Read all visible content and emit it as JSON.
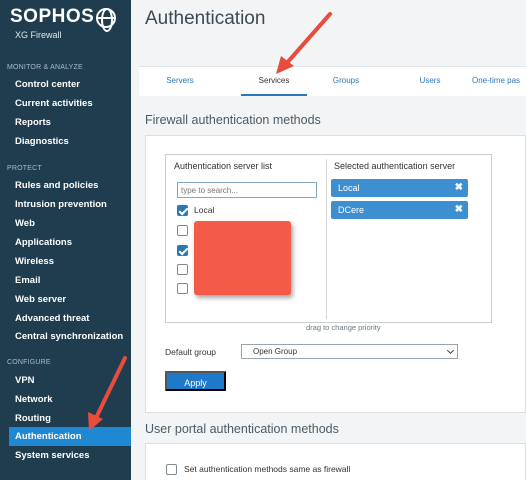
{
  "brand": {
    "name": "SOPHOS",
    "product": "XG Firewall"
  },
  "sidebar": {
    "sections": [
      {
        "title": "MONITOR & ANALYZE",
        "items": [
          "Control center",
          "Current activities",
          "Reports",
          "Diagnostics"
        ]
      },
      {
        "title": "PROTECT",
        "items": [
          "Rules and policies",
          "Intrusion prevention",
          "Web",
          "Applications",
          "Wireless",
          "Email",
          "Web server",
          "Advanced threat",
          "Central synchronization"
        ]
      },
      {
        "title": "CONFIGURE",
        "items": [
          "VPN",
          "Network",
          "Routing",
          "Authentication",
          "System services"
        ]
      }
    ],
    "active_item": "Authentication"
  },
  "page": {
    "title": "Authentication"
  },
  "tabs": [
    {
      "label": "Servers",
      "active": false
    },
    {
      "label": "Services",
      "active": true
    },
    {
      "label": "Groups",
      "active": false
    },
    {
      "label": "Users",
      "active": false
    },
    {
      "label": "One-time pas",
      "active": false
    }
  ],
  "firewall_auth": {
    "heading": "Firewall authentication methods",
    "server_list_title": "Authentication server list",
    "search_placeholder": "type to search...",
    "servers": [
      {
        "label": "Local",
        "checked": true
      },
      {
        "label": "",
        "checked": false
      },
      {
        "label": "",
        "checked": true
      },
      {
        "label": "",
        "checked": false
      },
      {
        "label": "",
        "checked": false
      }
    ],
    "selected_title": "Selected authentication server",
    "selected": [
      "Local",
      "DCere"
    ],
    "remove_glyph": "✖",
    "drag_hint": "drag to change priority",
    "default_group_label": "Default group",
    "default_group_value": "Open Group",
    "apply_label": "Apply"
  },
  "user_portal_auth": {
    "heading": "User portal authentication methods",
    "same_as_firewall_label": "Set authentication methods same as firewall",
    "same_as_firewall_checked": false
  },
  "colors": {
    "sidebar_bg": "#1f3d4f",
    "accent": "#1e88d3",
    "chip": "#3d8fd1",
    "annotation_arrow": "#e74c3c",
    "redaction": "#f45a47"
  }
}
